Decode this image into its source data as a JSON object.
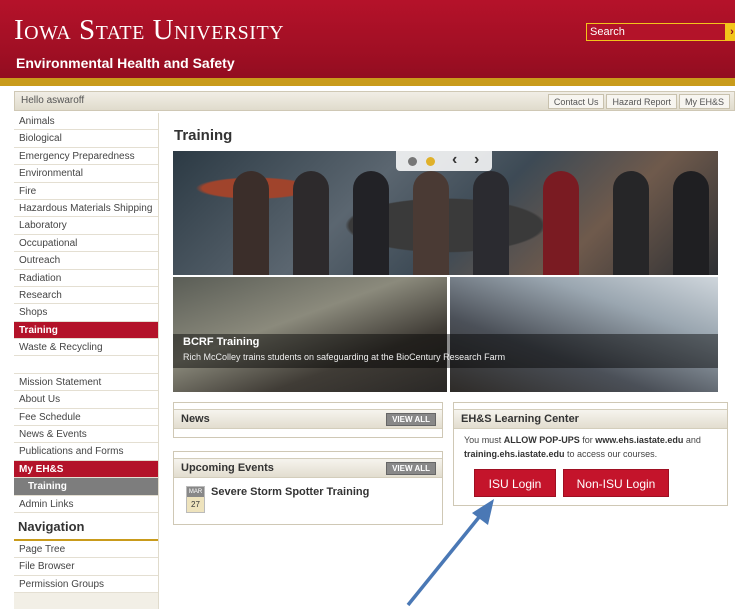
{
  "header": {
    "university": "Iowa State University",
    "department": "Environmental Health and Safety",
    "search_placeholder": "Search",
    "search_button_icon": "search-go-icon"
  },
  "topbar": {
    "greeting": "Hello aswaroff",
    "links": [
      "Contact Us",
      "Hazard Report",
      "My EH&S"
    ]
  },
  "sidebar": {
    "topics": [
      "Animals",
      "Biological",
      "Emergency Preparedness",
      "Environmental",
      "Fire",
      "Hazardous Materials Shipping",
      "Laboratory",
      "Occupational",
      "Outreach",
      "Radiation",
      "Research",
      "Shops",
      "Training",
      "Waste & Recycling"
    ],
    "info": [
      "Mission Statement",
      "About Us",
      "Fee Schedule",
      "News & Events",
      "Publications and Forms"
    ],
    "my_ehs": "My EH&S",
    "my_ehs_sub": "Training",
    "admin": "Admin Links",
    "navigation_heading": "Navigation",
    "navigation": [
      "Page Tree",
      "File Browser",
      "Permission Groups"
    ],
    "active_topic": "Training"
  },
  "main": {
    "title": "Training",
    "slideshow": {
      "caption_title": "BCRF Training",
      "caption_text": "Rich McColley trains students on safeguarding at the BioCentury Research Farm"
    },
    "news": {
      "title": "News",
      "view_all": "VIEW ALL"
    },
    "events": {
      "title": "Upcoming Events",
      "view_all": "VIEW ALL",
      "items": [
        {
          "month": "MAR",
          "day": "27",
          "title": "Severe Storm Spotter Training"
        }
      ]
    },
    "learning_center": {
      "title": "EH&S Learning Center",
      "text_1": "You must ",
      "text_bold_1": "ALLOW POP-UPS",
      "text_2": " for ",
      "text_bold_2": "www.ehs.iastate.edu",
      "text_3": " and ",
      "text_bold_3": "training.ehs.iastate.edu",
      "text_4": " to access our courses.",
      "isu_login": "ISU Login",
      "non_isu_login": "Non-ISU Login"
    }
  },
  "colors": {
    "brand_red": "#b31329",
    "gold": "#c99b1b",
    "arrow": "#4a78b5"
  }
}
